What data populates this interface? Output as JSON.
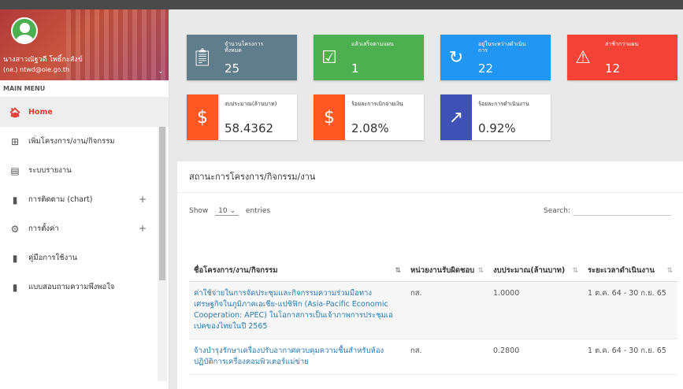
{
  "user": {
    "name": "นางสาวณัฐวดี โพธิ์กะสังข์",
    "email": "(กส.) ntwd@oie.go.th"
  },
  "sidebar": {
    "menu_title": "MAIN MENU",
    "items": [
      {
        "label": "Home",
        "icon": "home-icon",
        "active": true
      },
      {
        "label": "เพิ่มโครงการ/งาน/กิจกรรม",
        "icon": "plus-box-icon"
      },
      {
        "label": "ระบบรายงาน",
        "icon": "report-icon"
      },
      {
        "label": "การติดตาม (chart)",
        "icon": "bar-chart-icon",
        "expand": "+"
      },
      {
        "label": "การตั้งค่า",
        "icon": "gear-icon",
        "expand": "+"
      },
      {
        "label": "คู่มือการใช้งาน",
        "icon": "book-icon"
      },
      {
        "label": "แบบสอบถามความพึงพอใจ",
        "icon": "book-icon"
      }
    ]
  },
  "tiles": [
    {
      "label": "จำนวนโครงการทั้งหมด",
      "value": "25",
      "icon": "clipboard-icon",
      "color": "#607d8b",
      "full": true
    },
    {
      "label": "แล้วเสร็จตามแผน",
      "value": "1",
      "icon": "check-shield-icon",
      "color": "#4caf50",
      "full": true
    },
    {
      "label": "อยู่ในระหว่างดำเนินการ",
      "value": "22",
      "icon": "refresh-icon",
      "color": "#2196f3",
      "full": true
    },
    {
      "label": "ล่าช้ากว่าแผน",
      "value": "12",
      "icon": "warning-icon",
      "color": "#f44336",
      "full": true
    },
    {
      "label": "งบประมาณ(ล้านบาท)",
      "value": "58.4362",
      "icon": "dollar-icon",
      "color": "#ff5722",
      "full": false
    },
    {
      "label": "ร้อยละการเบิกจ่ายเงิน",
      "value": "2.08%",
      "icon": "dollar-icon",
      "color": "#ff5722",
      "full": false
    },
    {
      "label": "ร้อยละการดำเนินงาน",
      "value": "0.92%",
      "icon": "trending-up-icon",
      "color": "#3f51b5",
      "full": false
    }
  ],
  "table_card": {
    "title": "สถานะการโครงการ/กิจกรรม/งาน",
    "show_label": "Show",
    "entries_value": "10",
    "entries_label": "entries",
    "search_label": "Search:",
    "columns": [
      "ชื่อโครงการ/งาน/กิจกรรม",
      "หน่วยงานรับผิดชอบ",
      "งบประมาณ(ล้านบาท)",
      "ระยะเวลาดำเนินงาน"
    ],
    "rows": [
      {
        "name": "ค่าใช้จ่ายในการจัดประชุมและกิจกรรมความร่วมมือทางเศรษฐกิจในภูมิภาคเอเชีย-แปซิฟิก (Asia-Pacific Economic Cooperation: APEC) ในโอกาสการเป็นเจ้าภาพการประชุมเอเปคของไทยในปี 2565",
        "unit": "กส.",
        "budget": "1.0000",
        "period": "1 ต.ค. 64 - 30 ก.ย. 65"
      },
      {
        "name": "จ้างบำรุงรักษาเครื่องปรับอากาศควบคุมความชื้นสำหรับห้องปฏิบัติการเครื่องคอมพิวเตอร์แม่ข่าย",
        "unit": "กส.",
        "budget": "0.2800",
        "period": "1 ต.ค. 64 - 30 ก.ย. 65"
      }
    ]
  }
}
